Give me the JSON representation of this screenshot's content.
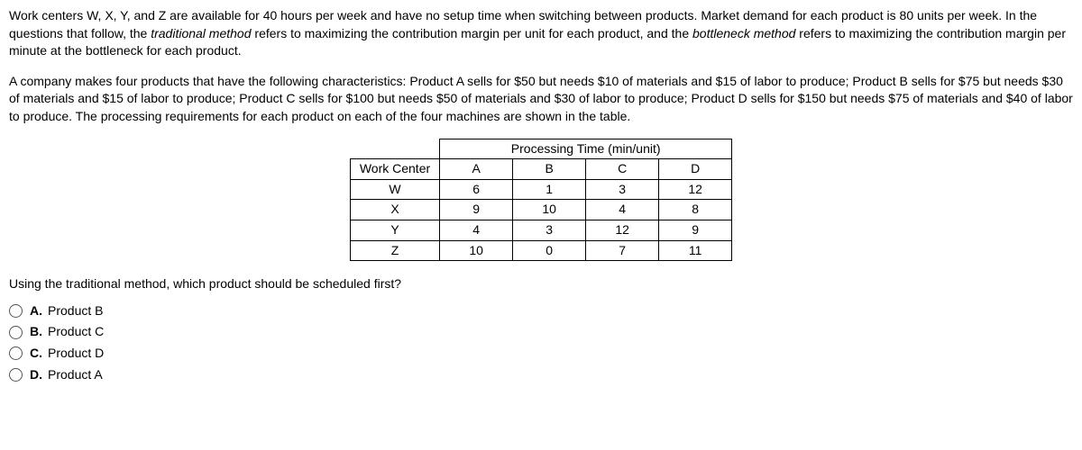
{
  "para1_a": "Work centers W, X, Y, and Z are available for 40 hours per week and have no setup time when switching between products. Market demand for each product is 80 units per week. In the questions that follow, the ",
  "para1_b": "traditional method",
  "para1_c": " refers to maximizing the contribution margin per unit for each product, and the ",
  "para1_d": "bottleneck method",
  "para1_e": " refers to maximizing the contribution margin per minute at the bottleneck for each product.",
  "para2": "A company makes four products that have the following characteristics: Product A sells for $50 but needs $10 of materials and $15 of labor to produce; Product B sells for $75 but needs $30 of materials and $15 of labor to produce; Product C sells for $100 but needs $50 of materials and $30 of labor to produce; Product D sells for $150 but needs $75 of materials and $40 of labor to produce. The processing requirements for each product on each of the four machines are shown in the table.",
  "table": {
    "title": "Processing Time (min/unit)",
    "corner": "Work Center",
    "cols": [
      "A",
      "B",
      "C",
      "D"
    ],
    "rows": [
      {
        "label": "W",
        "v": [
          "6",
          "1",
          "3",
          "12"
        ]
      },
      {
        "label": "X",
        "v": [
          "9",
          "10",
          "4",
          "8"
        ]
      },
      {
        "label": "Y",
        "v": [
          "4",
          "3",
          "12",
          "9"
        ]
      },
      {
        "label": "Z",
        "v": [
          "10",
          "0",
          "7",
          "11"
        ]
      }
    ]
  },
  "question": "Using the traditional method, which product should be scheduled first?",
  "options": [
    {
      "letter": "A.",
      "text": "Product B"
    },
    {
      "letter": "B.",
      "text": "Product C"
    },
    {
      "letter": "C.",
      "text": "Product D"
    },
    {
      "letter": "D.",
      "text": "Product A"
    }
  ]
}
